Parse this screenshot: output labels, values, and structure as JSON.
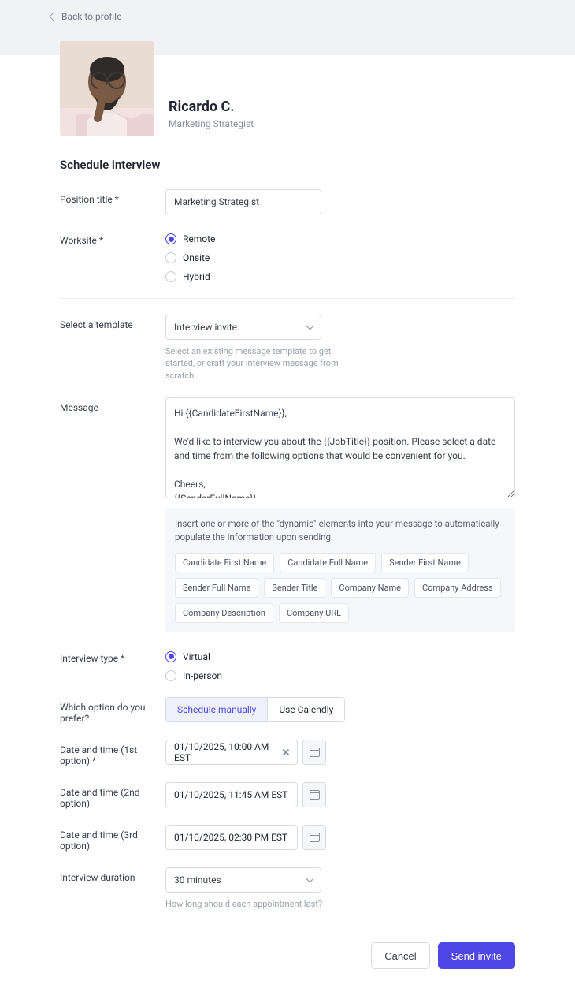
{
  "back_link": "Back to profile",
  "profile": {
    "name": "Ricardo C.",
    "role": "Marketing Strategist"
  },
  "section_title": "Schedule interview",
  "labels": {
    "position": "Position title *",
    "worksite": "Worksite *",
    "template": "Select a template",
    "message": "Message",
    "interview_type": "Interview type *",
    "schedule_pref": "Which option do you prefer?",
    "dt1": "Date and time (1st option) *",
    "dt2": "Date and time (2nd option)",
    "dt3": "Date and time (3rd option)",
    "duration": "Interview duration"
  },
  "position_value": "Marketing Strategist",
  "worksite": {
    "options": [
      "Remote",
      "Onsite",
      "Hybrid"
    ],
    "selected": "Remote"
  },
  "template": {
    "value": "Interview invite",
    "helper": "Select an existing message template to get started, or craft your interview message from scratch."
  },
  "message_value": "Hi {{CandidateFirstName}},\n\nWe'd like to interview you about the {{JobTitle}} position. Please select a date and time from the following options that would be convenient for you.\n\nCheers,\n{{SenderFullName}}",
  "dynamic": {
    "intro": "Insert one or more of the \"dynamic\" elements into your message to automatically populate the information upon sending.",
    "tags": [
      "Candidate First Name",
      "Candidate Full Name",
      "Sender First Name",
      "Sender Full Name",
      "Sender Title",
      "Company Name",
      "Company Address",
      "Company Description",
      "Company URL"
    ]
  },
  "interview_type": {
    "options": [
      "Virtual",
      "In-person"
    ],
    "selected": "Virtual"
  },
  "schedule_pref": {
    "options": [
      "Schedule manually",
      "Use Calendly"
    ],
    "selected": "Schedule manually"
  },
  "datetimes": {
    "opt1": "01/10/2025, 10:00 AM EST",
    "opt2": "01/10/2025, 11:45 AM EST",
    "opt3": "01/10/2025, 02:30 PM EST"
  },
  "duration": {
    "value": "30 minutes",
    "helper": "How long should each appointment last?"
  },
  "footer": {
    "cancel": "Cancel",
    "submit": "Send invite"
  }
}
